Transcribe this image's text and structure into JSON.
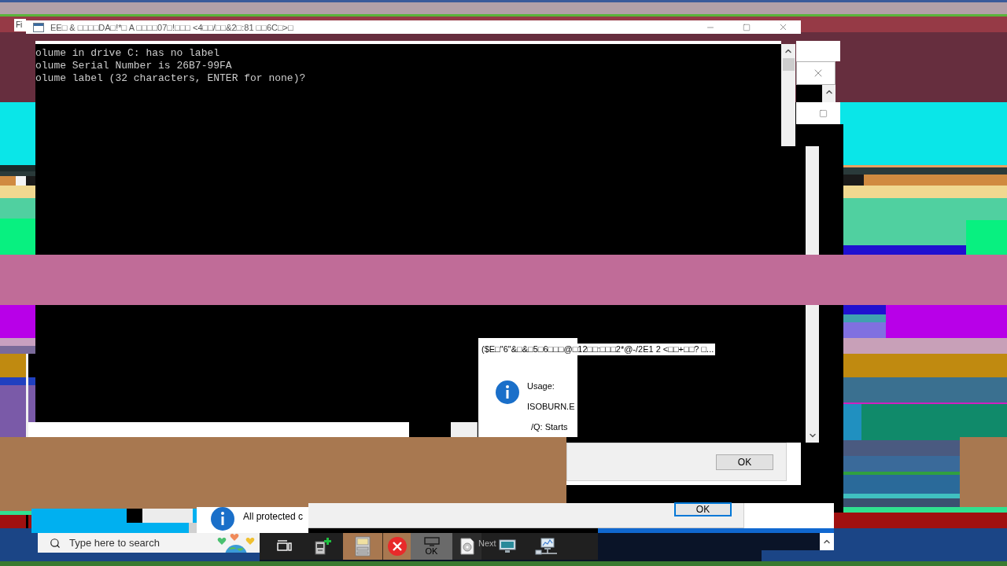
{
  "side_window": {
    "title": "Fi"
  },
  "console": {
    "title": "EE□ & □□□□DA□!*□ A □□□□07□!□□□ <4□□/□□&2□:81 □□6C□>□",
    "lines": [
      "olume in drive C: has no label",
      "olume Serial Number is 26B7-99FA",
      "olume label (32 characters, ENTER for none)?"
    ]
  },
  "message_box": {
    "title": "($E□\"6\"&□&□5□6□□□@□12□□:□□□2*@-/2E1 2 <□□+□□? □...",
    "lines": [
      "Usage:",
      "ISOBURN.E",
      "/Q: Starts"
    ],
    "button": "OK"
  },
  "message_box_2": {
    "button": {
      "label": "OK",
      "focused": true
    }
  },
  "notification": {
    "text": "All protected c"
  },
  "taskbar": {
    "search": {
      "placeholder": "Type here to search"
    },
    "labels": [
      "OK",
      "Next"
    ]
  }
}
